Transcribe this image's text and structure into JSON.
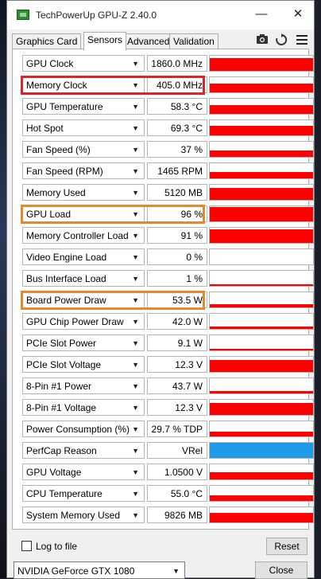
{
  "window": {
    "title": "TechPowerUp GPU-Z 2.40.0"
  },
  "titlebar": {
    "minimize": "—",
    "close": "✕"
  },
  "tabs": [
    {
      "label": "Graphics Card"
    },
    {
      "label": "Sensors"
    },
    {
      "label": "Advanced"
    },
    {
      "label": "Validation"
    }
  ],
  "toolbar": {
    "camera_icon": "camera-icon",
    "refresh_icon": "refresh-icon",
    "menu_icon": "menu-icon"
  },
  "sensors": [
    {
      "label": "GPU Clock",
      "value": "1860.0 MHz",
      "graph_color": "#ff0000",
      "graph_level": 0.85
    },
    {
      "label": "Memory Clock",
      "value": "405.0 MHz",
      "graph_color": "#ff0000",
      "graph_level": 0.6,
      "highlight": "#d9262c"
    },
    {
      "label": "GPU Temperature",
      "value": "58.3 °C",
      "graph_color": "#ff0000",
      "graph_level": 0.6
    },
    {
      "label": "Hot Spot",
      "value": "69.3 °C",
      "graph_color": "#ff0000",
      "graph_level": 0.65
    },
    {
      "label": "Fan Speed (%)",
      "value": "37 %",
      "graph_color": "#ff0000",
      "graph_level": 0.4
    },
    {
      "label": "Fan Speed (RPM)",
      "value": "1465 RPM",
      "graph_color": "#ff0000",
      "graph_level": 0.4
    },
    {
      "label": "Memory Used",
      "value": "5120 MB",
      "graph_color": "#ff0000",
      "graph_level": 0.8
    },
    {
      "label": "GPU Load",
      "value": "96 %",
      "graph_color": "#ff0000",
      "graph_level": 0.96,
      "highlight": "#e38a2c"
    },
    {
      "label": "Memory Controller Load",
      "value": "91 %",
      "graph_color": "#ff0000",
      "graph_level": 0.91
    },
    {
      "label": "Video Engine Load",
      "value": "0 %",
      "graph_color": "#ff0000",
      "graph_level": 0.0
    },
    {
      "label": "Bus Interface Load",
      "value": "1 %",
      "graph_color": "#ff0000",
      "graph_level": 0.05
    },
    {
      "label": "Board Power Draw",
      "value": "53.5 W",
      "graph_color": "#ff0000",
      "graph_level": 0.2,
      "highlight": "#e38a2c"
    },
    {
      "label": "GPU Chip Power Draw",
      "value": "42.0 W",
      "graph_color": "#ff0000",
      "graph_level": 0.15
    },
    {
      "label": "PCIe Slot Power",
      "value": "9.1 W",
      "graph_color": "#ff0000",
      "graph_level": 0.12
    },
    {
      "label": "PCIe Slot Voltage",
      "value": "12.3 V",
      "graph_color": "#ff0000",
      "graph_level": 0.8
    },
    {
      "label": "8-Pin #1 Power",
      "value": "43.7 W",
      "graph_color": "#ff0000",
      "graph_level": 0.15
    },
    {
      "label": "8-Pin #1 Voltage",
      "value": "12.3 V",
      "graph_color": "#ff0000",
      "graph_level": 0.8
    },
    {
      "label": "Power Consumption (%)",
      "value": "29.7 % TDP",
      "graph_color": "#ff0000",
      "graph_level": 0.3
    },
    {
      "label": "PerfCap Reason",
      "value": "VRel",
      "graph_color": "#1e9be8",
      "graph_level": 1.0
    },
    {
      "label": "GPU Voltage",
      "value": "1.0500 V",
      "graph_color": "#ff0000",
      "graph_level": 0.45
    },
    {
      "label": "CPU Temperature",
      "value": "55.0 °C",
      "graph_color": "#ff0000",
      "graph_level": 0.35
    },
    {
      "label": "System Memory Used",
      "value": "9826 MB",
      "graph_color": "#ff0000",
      "graph_level": 0.65
    }
  ],
  "footer": {
    "log_to_file": "Log to file",
    "reset": "Reset",
    "gpu_select": "NVIDIA GeForce GTX 1080",
    "close": "Close"
  }
}
